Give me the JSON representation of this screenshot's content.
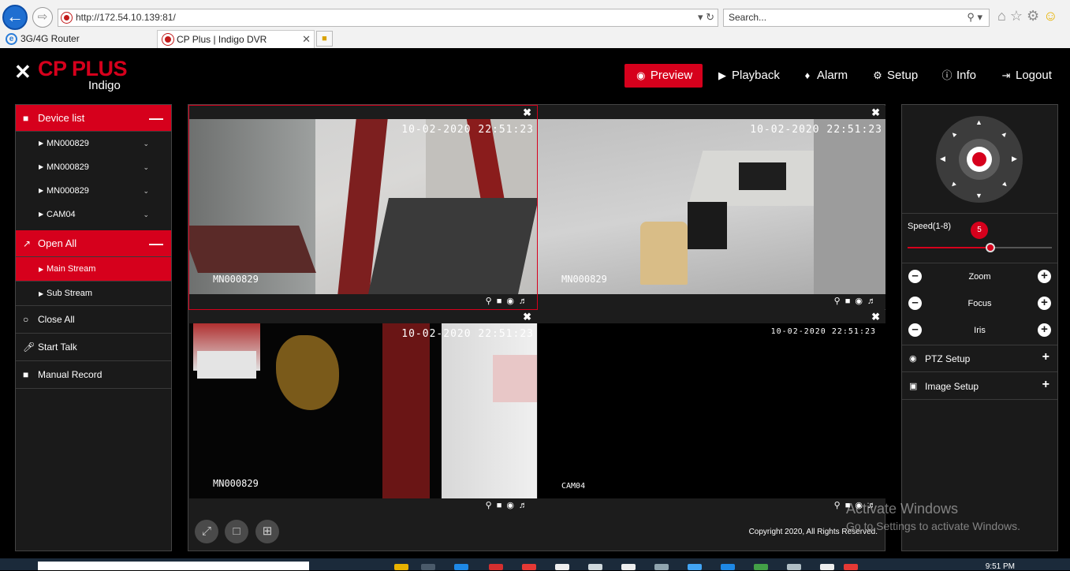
{
  "browser": {
    "url": "http://172.54.10.139:81/",
    "search_placeholder": "Search...",
    "tabs": [
      {
        "label": "3G/4G Router",
        "active": false
      },
      {
        "label": "CP Plus | Indigo DVR",
        "active": true
      }
    ]
  },
  "app": {
    "logo_text": "CP PLUS",
    "logo_sub": "Indigo",
    "nav": [
      {
        "label": "Preview",
        "icon": "eye-icon",
        "active": true
      },
      {
        "label": "Playback",
        "icon": "play-icon"
      },
      {
        "label": "Alarm",
        "icon": "bell-icon"
      },
      {
        "label": "Setup",
        "icon": "gear-icon"
      },
      {
        "label": "Info",
        "icon": "info-icon"
      },
      {
        "label": "Logout",
        "icon": "logout-icon"
      }
    ],
    "accent_color": "#d6001c"
  },
  "left_panel": {
    "device_list_label": "Device list",
    "devices": [
      "MN000829",
      "MN000829",
      "MN000829",
      "CAM04"
    ],
    "open_all_label": "Open All",
    "streams": [
      {
        "label": "Main Stream",
        "active": true
      },
      {
        "label": "Sub Stream",
        "active": false
      }
    ],
    "actions": [
      {
        "label": "Close All",
        "icon": "circle-icon"
      },
      {
        "label": "Start Talk",
        "icon": "microphone-icon"
      },
      {
        "label": "Manual Record",
        "icon": "video-camera-icon"
      }
    ]
  },
  "video": {
    "cells": [
      {
        "timestamp": "10-02-2020 22:51:23",
        "name": "MN000829",
        "selected": true
      },
      {
        "timestamp": "10-02-2020 22:51:23",
        "name": "MN000829",
        "selected": false
      },
      {
        "timestamp": "10-02-2020 22:51:23",
        "name": "MN000829",
        "selected": false
      },
      {
        "timestamp": "10-02-2020 22:51:23",
        "name": "CAM04",
        "selected": false
      }
    ],
    "copyright": "Copyright 2020, All Rights Reserved."
  },
  "ptz": {
    "speed_label": "Speed(1-8)",
    "speed_value": "5",
    "speed_min": 1,
    "speed_max": 8,
    "controls": [
      "Zoom",
      "Focus",
      "Iris"
    ],
    "sections": [
      {
        "label": "PTZ Setup",
        "icon": "gamepad-icon"
      },
      {
        "label": "Image Setup",
        "icon": "image-icon"
      }
    ]
  },
  "watermark": {
    "line1": "Activate Windows",
    "line2": "Go to Settings to activate Windows."
  },
  "taskbar": {
    "clock": "9:51 PM"
  }
}
